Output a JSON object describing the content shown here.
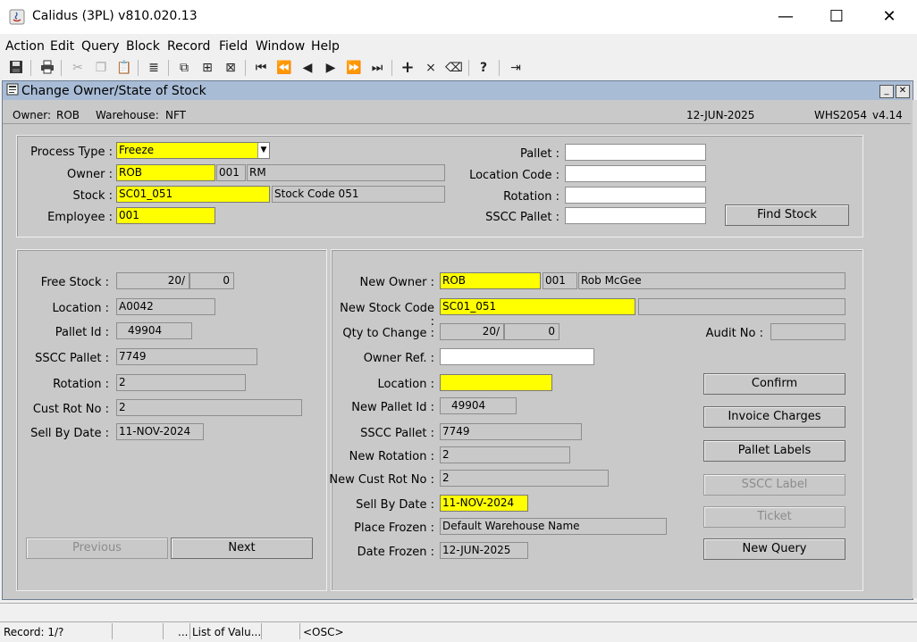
{
  "window": {
    "title": "Calidus (3PL) v810.020.13",
    "minimize": "—",
    "maximize": "☐",
    "close": "✕"
  },
  "menu": [
    "Action",
    "Edit",
    "Query",
    "Block",
    "Record",
    "Field",
    "Window",
    "Help"
  ],
  "form": {
    "title": "Change Owner/State of Stock",
    "owner_label": "Owner:",
    "owner": "ROB",
    "warehouse_label": "Warehouse:",
    "warehouse": "NFT",
    "date": "12-JUN-2025",
    "form_code": "WHS2054",
    "version": "v4.14"
  },
  "top": {
    "process_type_label": "Process Type :",
    "process_type": "Freeze",
    "owner_label": "Owner :",
    "owner_code": "ROB",
    "owner_num": "001",
    "owner_name": "RM",
    "stock_label": "Stock :",
    "stock_code": "SC01_051",
    "stock_desc": "Stock Code 051",
    "employee_label": "Employee :",
    "employee": "001",
    "pallet_label": "Pallet :",
    "location_code_label": "Location Code :",
    "rotation_label": "Rotation :",
    "sscc_pallet_label": "SSCC Pallet :",
    "find_stock": "Find Stock"
  },
  "left": {
    "free_stock_label": "Free Stock :",
    "free_stock_a": "20/",
    "free_stock_b": "0",
    "location_label": "Location :",
    "location": "A0042",
    "pallet_id_label": "Pallet Id :",
    "pallet_id": "49904",
    "sscc_pallet_label": "SSCC Pallet :",
    "sscc_pallet": "7749",
    "rotation_label": "Rotation :",
    "rotation": "2",
    "cust_rot_label": "Cust Rot No :",
    "cust_rot": "2",
    "sell_by_label": "Sell By Date :",
    "sell_by": "11-NOV-2024",
    "previous": "Previous",
    "next": "Next"
  },
  "right": {
    "new_owner_label": "New Owner :",
    "new_owner": "ROB",
    "new_owner_num": "001",
    "new_owner_name": "Rob McGee",
    "new_stock_code_label": "New Stock Code :",
    "new_stock_code": "SC01_051",
    "qty_label": "Qty to Change :",
    "qty_a": "20/",
    "qty_b": "0",
    "audit_label": "Audit No :",
    "owner_ref_label": "Owner Ref. :",
    "location_label": "Location :",
    "new_pallet_label": "New Pallet Id :",
    "new_pallet": "49904",
    "sscc_pallet_label": "SSCC Pallet :",
    "sscc_pallet": "7749",
    "new_rotation_label": "New Rotation :",
    "new_rotation": "2",
    "new_cust_rot_label": "New Cust Rot No :",
    "new_cust_rot": "2",
    "sell_by_label": "Sell By Date :",
    "sell_by": "11-NOV-2024",
    "place_frozen_label": "Place Frozen :",
    "place_frozen": "Default Warehouse Name",
    "date_frozen_label": "Date Frozen :",
    "date_frozen": "12-JUN-2025",
    "confirm": "Confirm",
    "invoice_charges": "Invoice Charges",
    "pallet_labels": "Pallet Labels",
    "sscc_label": "SSCC Label",
    "ticket": "Ticket",
    "new_query": "New Query"
  },
  "status": {
    "record": "Record: 1/?",
    "ellipsis": "...",
    "lov": "List of Valu...",
    "osc": "<OSC>"
  }
}
